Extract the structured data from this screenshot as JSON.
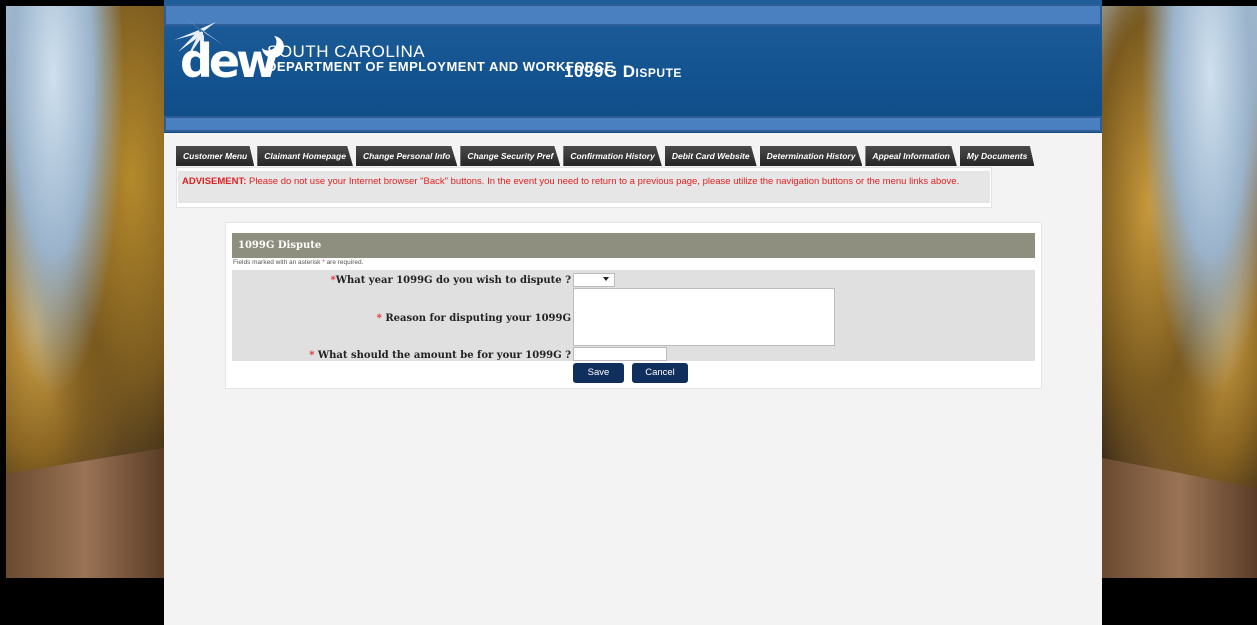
{
  "header": {
    "title_first": "1099G",
    "title_second": "Dispute",
    "logo_text": "dew",
    "org_line1": "SOUTH CAROLINA",
    "org_line2": "DEPARTMENT OF EMPLOYMENT AND WORKFORCE",
    "brand_color": "#12528f"
  },
  "tabs": [
    {
      "label": "Customer Menu"
    },
    {
      "label": "Claimant Homepage"
    },
    {
      "label": "Change Personal Info"
    },
    {
      "label": "Change Security Pref"
    },
    {
      "label": "Confirmation History"
    },
    {
      "label": "Debit Card Website"
    },
    {
      "label": "Determination History"
    },
    {
      "label": "Appeal Information"
    },
    {
      "label": "My Documents"
    }
  ],
  "advisement": {
    "lead": "ADVISEMENT:",
    "text": " Please do not use your Internet browser \"Back\" buttons. In the event you need to return to a previous page, please utilize the navigation buttons or the menu links above."
  },
  "form": {
    "heading": "1099G Dispute",
    "note_before": "Fields marked with an asterisk ",
    "note_star": "*",
    "note_after": " are required.",
    "year_label": "What year 1099G do you wish to dispute ?",
    "year_value": "",
    "reason_label": "Reason for disputing your 1099G",
    "reason_value": "",
    "amount_label": "What should the amount be for your 1099G ?",
    "amount_value": "",
    "required_mark": "*",
    "save_label": "Save",
    "cancel_label": "Cancel"
  }
}
